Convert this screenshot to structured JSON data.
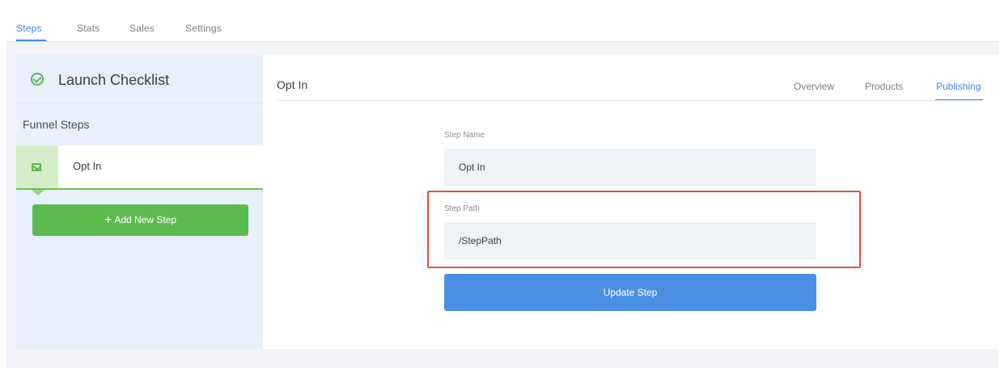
{
  "top_tabs": [
    {
      "label": "Steps",
      "active": true
    },
    {
      "label": "Stats",
      "active": false
    },
    {
      "label": "Sales",
      "active": false
    },
    {
      "label": "Settings",
      "active": false
    }
  ],
  "sidebar": {
    "checklist_title": "Launch Checklist",
    "checklist_icon": "check-circle-icon",
    "funnel_steps_label": "Funnel Steps",
    "steps": [
      {
        "name": "Opt In",
        "icon": "mail-icon",
        "selected": true
      }
    ],
    "add_step_plus": "+",
    "add_step_label": "Add New Step"
  },
  "main": {
    "page_title": "Opt In",
    "sub_tabs": [
      {
        "label": "Overview",
        "active": false
      },
      {
        "label": "Products",
        "active": false
      },
      {
        "label": "Publishing",
        "active": true
      }
    ],
    "step_name_label": "Step Name",
    "step_name_value": "Opt In",
    "step_path_label": "Step Path",
    "step_path_value": "/StepPath",
    "update_button_label": "Update Step"
  },
  "colors": {
    "accent_blue": "#3f88e8",
    "button_blue": "#4a90e2",
    "add_green": "#5cbb4d",
    "highlight_red": "#e0513f"
  }
}
